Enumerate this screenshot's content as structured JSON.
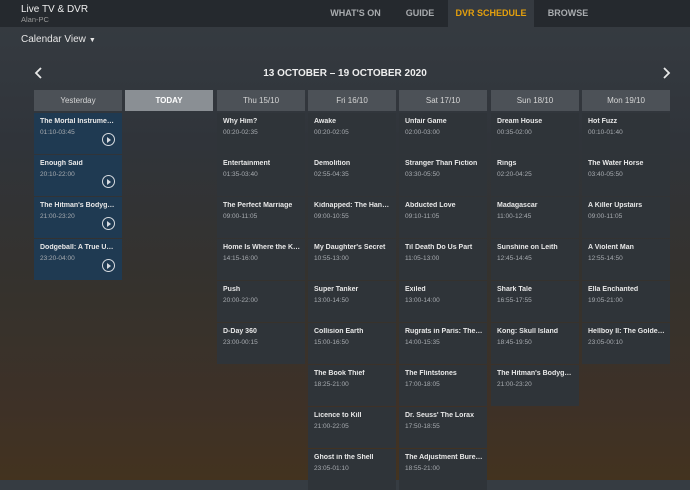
{
  "app": {
    "title": "Live TV & DVR",
    "subtitle": "Alan-PC"
  },
  "nav": [
    {
      "label": "WHAT'S ON"
    },
    {
      "label": "GUIDE"
    },
    {
      "label": "DVR SCHEDULE",
      "active": true
    },
    {
      "label": "BROWSE"
    }
  ],
  "colors": {
    "accent": "#e5a00d"
  },
  "view": {
    "label": "Calendar View",
    "chevron_icon": "caret-down-icon"
  },
  "calendar": {
    "range": "13 OCTOBER – 19 OCTOBER 2020",
    "prev_icon": "chevron-left-icon",
    "next_icon": "chevron-right-icon",
    "columns": [
      {
        "label": "Yesterday",
        "style": "yesterday",
        "items": [
          {
            "title": "The Mortal Instruments...",
            "time": "01:10-03:45",
            "recorded": true
          },
          {
            "title": "Enough Said",
            "time": "20:10-22:00",
            "recorded": true
          },
          {
            "title": "The Hitman's Bodyguard",
            "time": "21:00-23:20",
            "recorded": true
          },
          {
            "title": "Dodgeball: A True Unde...",
            "time": "23:20-04:00",
            "recorded": true
          }
        ]
      },
      {
        "label": "TODAY",
        "style": "today",
        "items": []
      },
      {
        "label": "Thu 15/10",
        "items": [
          {
            "title": "Why Him?",
            "time": "00:20-02:35"
          },
          {
            "title": "Entertainment",
            "time": "01:35-03:40"
          },
          {
            "title": "The Perfect Marriage",
            "time": "09:00-11:05"
          },
          {
            "title": "Home Is Where the Kill...",
            "time": "14:15-16:00"
          },
          {
            "title": "Push",
            "time": "20:00-22:00"
          },
          {
            "title": "D-Day 360",
            "time": "23:00-00:15"
          }
        ]
      },
      {
        "label": "Fri 16/10",
        "items": [
          {
            "title": "Awake",
            "time": "00:20-02:05"
          },
          {
            "title": "Demolition",
            "time": "02:55-04:35"
          },
          {
            "title": "Kidnapped: The Hanna...",
            "time": "09:00-10:55"
          },
          {
            "title": "My Daughter's Secret",
            "time": "10:55-13:00"
          },
          {
            "title": "Super Tanker",
            "time": "13:00-14:50"
          },
          {
            "title": "Collision Earth",
            "time": "15:00-16:50"
          },
          {
            "title": "The Book Thief",
            "time": "18:25-21:00"
          },
          {
            "title": "Licence to Kill",
            "time": "21:00-22:05"
          },
          {
            "title": "Ghost in the Shell",
            "time": "23:05-01:10"
          }
        ]
      },
      {
        "label": "Sat 17/10",
        "items": [
          {
            "title": "Unfair Game",
            "time": "02:00-03:00"
          },
          {
            "title": "Stranger Than Fiction",
            "time": "03:30-05:50"
          },
          {
            "title": "Abducted Love",
            "time": "09:10-11:05"
          },
          {
            "title": "Til Death Do Us Part",
            "time": "11:05-13:00"
          },
          {
            "title": "Exiled",
            "time": "13:00-14:00"
          },
          {
            "title": "Rugrats in Paris: The M...",
            "time": "14:00-15:35"
          },
          {
            "title": "The Flintstones",
            "time": "17:00-18:05"
          },
          {
            "title": "Dr. Seuss' The Lorax",
            "time": "17:50-18:55"
          },
          {
            "title": "The Adjustment Bureau",
            "time": "18:55-21:00"
          }
        ]
      },
      {
        "label": "Sun 18/10",
        "items": [
          {
            "title": "Dream House",
            "time": "00:35-02:00"
          },
          {
            "title": "Rings",
            "time": "02:20-04:25"
          },
          {
            "title": "Madagascar",
            "time": "11:00-12:45"
          },
          {
            "title": "Sunshine on Leith",
            "time": "12:45-14:45"
          },
          {
            "title": "Shark Tale",
            "time": "16:55-17:55"
          },
          {
            "title": "Kong: Skull Island",
            "time": "18:45-19:50"
          },
          {
            "title": "The Hitman's Bodyguard",
            "time": "21:00-23:20"
          }
        ]
      },
      {
        "label": "Mon 19/10",
        "items": [
          {
            "title": "Hot Fuzz",
            "time": "00:10-01:40"
          },
          {
            "title": "The Water Horse",
            "time": "03:40-05:50"
          },
          {
            "title": "A Killer Upstairs",
            "time": "09:00-11:05"
          },
          {
            "title": "A Violent Man",
            "time": "12:55-14:50"
          },
          {
            "title": "Ella Enchanted",
            "time": "19:05-21:00"
          },
          {
            "title": "Hellboy II: The Golden A...",
            "time": "23:05-00:10"
          }
        ]
      }
    ]
  }
}
